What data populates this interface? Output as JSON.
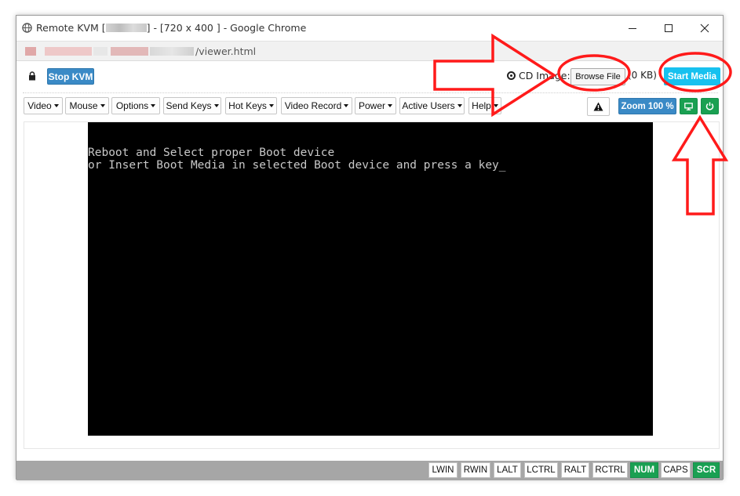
{
  "window": {
    "title_prefix": "Remote KVM [",
    "title_suffix": "] - [720 x 400 ] - Google Chrome",
    "url_path": "/viewer.html"
  },
  "toolbar": {
    "stop_kvm": "Stop KVM",
    "cd_image_label": "CD Image:",
    "browse_file": "Browse File",
    "file_size": "(0 KB)",
    "start_media": "Start Media"
  },
  "menus": [
    {
      "label": "Video"
    },
    {
      "label": "Mouse"
    },
    {
      "label": "Options"
    },
    {
      "label": "Send Keys"
    },
    {
      "label": "Hot Keys"
    },
    {
      "label": "Video Record"
    },
    {
      "label": "Power"
    },
    {
      "label": "Active Users"
    },
    {
      "label": "Help"
    }
  ],
  "zoom_label": "Zoom 100 %",
  "console": {
    "line1": "Reboot and Select proper Boot device",
    "line2": "or Insert Boot Media in selected Boot device and press a key_"
  },
  "status_keys": [
    {
      "label": "LWIN",
      "active": false
    },
    {
      "label": "RWIN",
      "active": false
    },
    {
      "label": "LALT",
      "active": false
    },
    {
      "label": "LCTRL",
      "active": false
    },
    {
      "label": "RALT",
      "active": false
    },
    {
      "label": "RCTRL",
      "active": false
    },
    {
      "label": "NUM",
      "active": true
    },
    {
      "label": "CAPS",
      "active": false
    },
    {
      "label": "SCR",
      "active": true
    }
  ],
  "colors": {
    "primary_button": "#3a8ac6",
    "start_media": "#17c1ef",
    "active_green": "#1aa052",
    "annotation_red": "#ff1a1a",
    "status_bar": "#a6a6a6"
  },
  "icons": [
    "globe-icon",
    "minimize-icon",
    "maximize-icon",
    "close-icon",
    "lock-icon",
    "cd-icon",
    "warning-icon",
    "monitor-icon",
    "power-icon"
  ]
}
